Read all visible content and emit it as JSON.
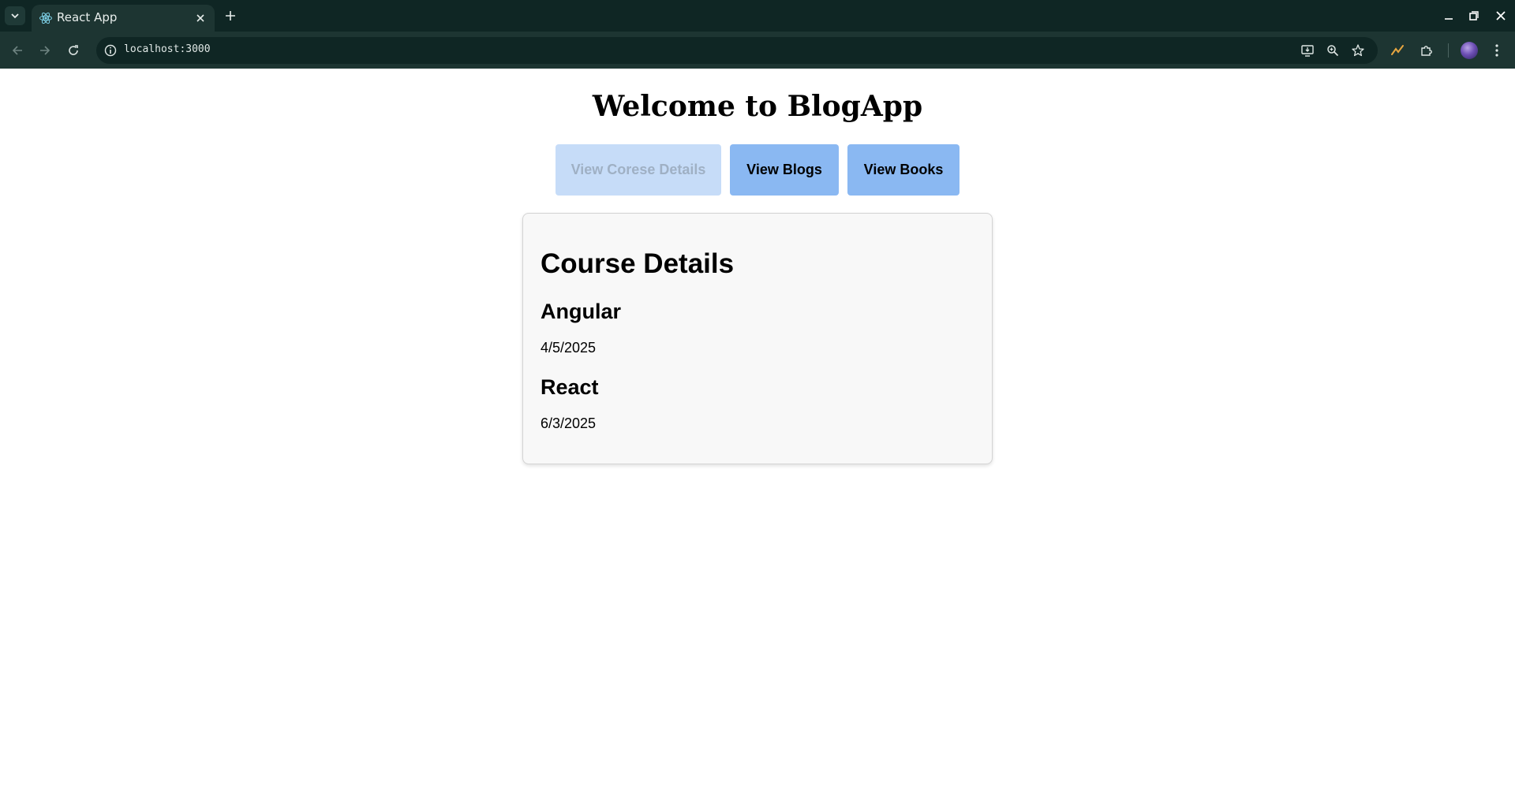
{
  "browser": {
    "tab_title": "React App",
    "url": "localhost:3000"
  },
  "page": {
    "title": "Welcome to BlogApp",
    "buttons": [
      {
        "label": "View Corese Details",
        "state": "disabled"
      },
      {
        "label": "View Blogs",
        "state": "enabled"
      },
      {
        "label": "View Books",
        "state": "enabled"
      }
    ],
    "card": {
      "heading": "Course Details",
      "courses": [
        {
          "name": "Angular",
          "date": "4/5/2025"
        },
        {
          "name": "React",
          "date": "6/3/2025"
        }
      ]
    }
  },
  "colors": {
    "button_active": "#8ab8f2",
    "button_disabled": "#c6dcf8",
    "browser_frame": "#0f2624",
    "browser_toolbar": "#1d3532"
  },
  "icons": [
    "tab-search-icon",
    "react-logo-icon",
    "close-icon",
    "plus-icon",
    "minimize-icon",
    "restore-icon",
    "back-arrow-icon",
    "forward-arrow-icon",
    "reload-icon",
    "info-icon",
    "install-app-icon",
    "zoom-icon",
    "star-icon",
    "extension-pen-icon",
    "puzzle-icon",
    "more-menu-icon"
  ]
}
